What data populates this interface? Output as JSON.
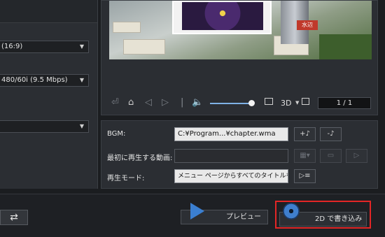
{
  "left": {
    "dropdowns": [
      "(16:9)",
      "480/60i (9.5 Mbps)",
      ""
    ]
  },
  "preview": {
    "sign_text": "水辺"
  },
  "player": {
    "label_3d": "3D",
    "page_counter": "1 / 1"
  },
  "settings": {
    "bgm_label": "BGM:",
    "bgm_value": "C:¥Program...¥chapter.wma",
    "first_video_label": "最初に再生する動画:",
    "first_video_value": "",
    "playback_mode_label": "再生モード:",
    "playback_mode_value": "メニュー ページからすべてのタイトルを順番に"
  },
  "bottom": {
    "preview_label": "プレビュー",
    "burn_label": "2D で書き込み"
  },
  "colors": {
    "accent_blue": "#3b7fd1",
    "highlight_red": "#e32626"
  }
}
